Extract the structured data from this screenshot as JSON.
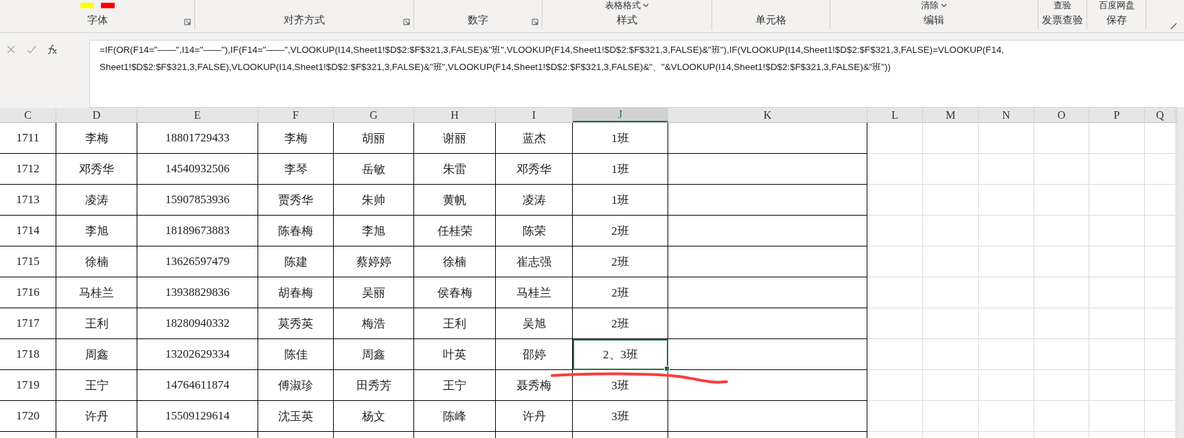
{
  "ribbon": {
    "groups": [
      {
        "label": "字体",
        "launcher": true,
        "swatches": [
          {
            "color": "#ffff00"
          },
          {
            "color": "#ff0000"
          }
        ]
      },
      {
        "label": "对齐方式",
        "launcher": true
      },
      {
        "label": "数字",
        "launcher": true
      },
      {
        "label": "样式",
        "launcher": false,
        "buttons": [
          {
            "label": "表格格式",
            "dropdown": true
          }
        ]
      },
      {
        "label": "单元格",
        "launcher": false
      },
      {
        "label": "编辑",
        "launcher": false,
        "buttons": [
          {
            "label": "清除",
            "dropdown": true
          }
        ]
      },
      {
        "label": "发票查验",
        "launcher": false,
        "buttons": [
          {
            "label": "查验",
            "dropdown": false
          }
        ]
      },
      {
        "label": "保存",
        "launcher": false,
        "buttons": [
          {
            "label": "百度网盘",
            "dropdown": false
          }
        ]
      }
    ]
  },
  "formula_bar": {
    "lines": [
      "=IF(OR(F14=\"——\",I14=\"——\"),IF(F14=\"——\",VLOOKUP(I14,Sheet1!$D$2:$F$321,3,FALSE)&\"班\",VLOOKUP(F14,Sheet1!$D$2:$F$321,3,FALSE)&\"班\"),IF(VLOOKUP(I14,Sheet1!$D$2:$F$321,3,FALSE)=VLOOKUP(F14,",
      "Sheet1!$D$2:$F$321,3,FALSE),VLOOKUP(I14,Sheet1!$D$2:$F$321,3,FALSE)&\"班\",VLOOKUP(F14,Sheet1!$D$2:$F$321,3,FALSE)&\"、\"&VLOOKUP(I14,Sheet1!$D$2:$F$321,3,FALSE)&\"班\"))"
    ]
  },
  "columns": [
    {
      "label": "C",
      "selected": false
    },
    {
      "label": "D",
      "selected": false
    },
    {
      "label": "E",
      "selected": false
    },
    {
      "label": "F",
      "selected": false
    },
    {
      "label": "G",
      "selected": false
    },
    {
      "label": "H",
      "selected": false
    },
    {
      "label": "I",
      "selected": false
    },
    {
      "label": "J",
      "selected": true
    },
    {
      "label": "K",
      "selected": false
    },
    {
      "label": "L",
      "selected": false
    },
    {
      "label": "M",
      "selected": false
    },
    {
      "label": "N",
      "selected": false
    },
    {
      "label": "O",
      "selected": false
    },
    {
      "label": "P",
      "selected": false
    },
    {
      "label": "Q",
      "selected": false
    }
  ],
  "rows": [
    {
      "selected": false,
      "cells": [
        "1711",
        "李梅",
        "18801729433",
        "李梅",
        "胡丽",
        "谢丽",
        "蓝杰",
        "1班"
      ]
    },
    {
      "selected": false,
      "cells": [
        "1712",
        "邓秀华",
        "14540932506",
        "李琴",
        "岳敏",
        "朱雷",
        "邓秀华",
        "1班"
      ]
    },
    {
      "selected": false,
      "cells": [
        "1713",
        "凌涛",
        "15907853936",
        "贾秀华",
        "朱帅",
        "黄帆",
        "凌涛",
        "1班"
      ]
    },
    {
      "selected": false,
      "cells": [
        "1714",
        "李旭",
        "18189673883",
        "陈春梅",
        "李旭",
        "任桂荣",
        "陈荣",
        "2班"
      ]
    },
    {
      "selected": false,
      "cells": [
        "1715",
        "徐楠",
        "13626597479",
        "陈建",
        "蔡婷婷",
        "徐楠",
        "崔志强",
        "2班"
      ]
    },
    {
      "selected": false,
      "cells": [
        "1716",
        "马桂兰",
        "13938829836",
        "胡春梅",
        "吴丽",
        "侯春梅",
        "马桂兰",
        "2班"
      ]
    },
    {
      "selected": false,
      "cells": [
        "1717",
        "王利",
        "18280940332",
        "莫秀英",
        "梅浩",
        "王利",
        "吴旭",
        "2班"
      ]
    },
    {
      "selected": true,
      "cells": [
        "1718",
        "周鑫",
        "13202629334",
        "陈佳",
        "周鑫",
        "叶英",
        "邵婷",
        "2、3班"
      ]
    },
    {
      "selected": false,
      "cells": [
        "1719",
        "王宁",
        "14764611874",
        "傅淑珍",
        "田秀芳",
        "王宁",
        "聂秀梅",
        "3班"
      ]
    },
    {
      "selected": false,
      "cells": [
        "1720",
        "许丹",
        "15509129614",
        "沈玉英",
        "杨文",
        "陈峰",
        "许丹",
        "3班"
      ]
    }
  ]
}
